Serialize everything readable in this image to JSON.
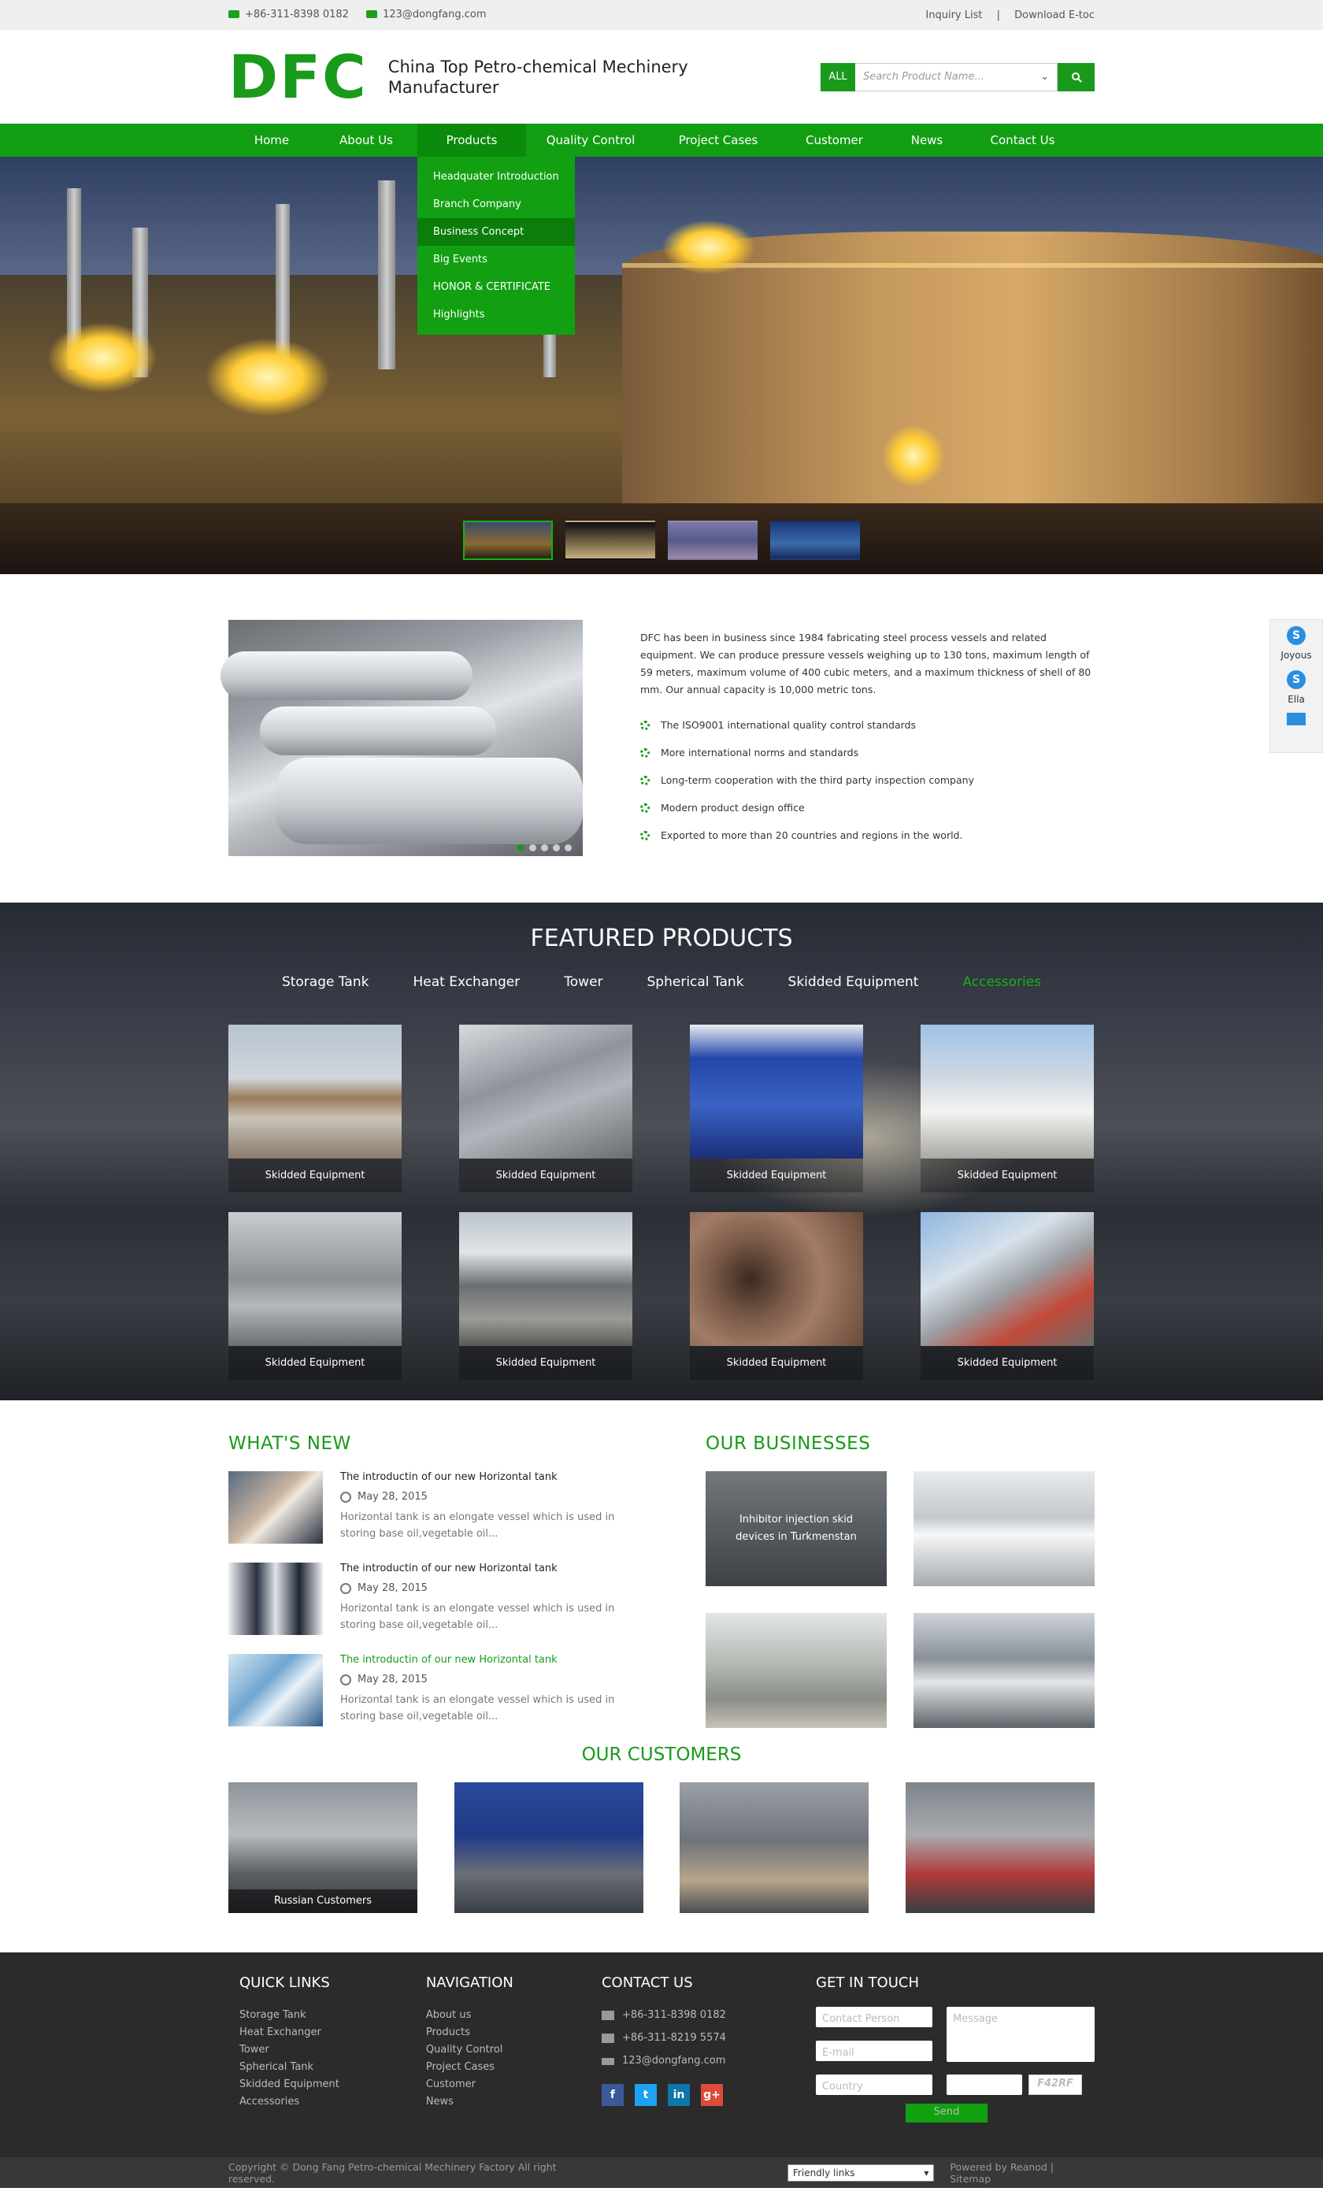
{
  "topbar": {
    "phone": "+86-311-8398 0182",
    "email": "123@dongfang.com",
    "inquiry": "Inquiry List",
    "separator": "|",
    "download": "Download E-toc"
  },
  "header": {
    "logo": "DFC",
    "tagline": "China Top Petro-chemical Mechinery Manufacturer",
    "search_scope": "ALL",
    "search_placeholder": "Search Product Name..."
  },
  "nav": {
    "items": [
      "Home",
      "About Us",
      "Products",
      "Quality Control",
      "Project Cases",
      "Customer",
      "News",
      "Contact Us"
    ],
    "active": "Products",
    "dropdown": [
      "Headquater Introduction",
      "Branch Company",
      "Business Concept",
      "Big Events",
      "HONOR & CERTIFICATE",
      "Highlights"
    ],
    "dropdown_highlight": "Business Concept"
  },
  "intro": {
    "text": "DFC has been in business since 1984 fabricating steel process vessels and related equipment. We can produce pressure vessels weighing up to 130 tons, maximum length of 59 meters, maximum volume of 400 cubic meters, and a maximum thickness of shell of 80 mm. Our annual capacity is 10,000 metric tons.",
    "features": [
      "The ISO9001 international quality control standards",
      "More international norms and standards",
      "Long-term cooperation with the third party inspection company",
      "Modern product design office",
      "Exported to more than 20 countries and regions in the world."
    ]
  },
  "side": {
    "contact1": "Joyous",
    "contact2": "Ella"
  },
  "featured": {
    "title": "FEATURED PRODUCTS",
    "tabs": [
      "Storage Tank",
      "Heat Exchanger",
      "Tower",
      "Spherical Tank",
      "Skidded Equipment",
      "Accessories"
    ],
    "active_tab": "Accessories",
    "products": [
      "Skidded Equipment",
      "Skidded Equipment",
      "Skidded Equipment",
      "Skidded Equipment",
      "Skidded Equipment",
      "Skidded Equipment",
      "Skidded Equipment",
      "Skidded Equipment"
    ]
  },
  "news": {
    "title": "WHAT'S NEW",
    "items": [
      {
        "title": "The introductin of our new Horizontal tank",
        "date": "May 28, 2015",
        "summary": "Horizontal tank is an elongate vessel which is used in storing base oil,vegetable oil..."
      },
      {
        "title": "The introductin of our new Horizontal tank",
        "date": "May 28, 2015",
        "summary": "Horizontal tank is an elongate vessel which is used in storing base oil,vegetable oil..."
      },
      {
        "title": "The introductin of our new Horizontal tank",
        "date": "May 28, 2015",
        "summary": "Horizontal tank is an elongate vessel which is used in storing base oil,vegetable oil..."
      }
    ]
  },
  "businesses": {
    "title": "OUR BUSINESSES",
    "overlay": "Inhibitor injection skid devices in Turkmenstan"
  },
  "customers": {
    "title": "OUR CUSTOMERS",
    "caption": "Russian Customers"
  },
  "footer": {
    "quick_title": "QUICK LINKS",
    "quick": [
      "Storage Tank",
      "Heat Exchanger",
      "Tower",
      "Spherical Tank",
      "Skidded Equipment",
      "Accessories"
    ],
    "nav_title": "NAVIGATION",
    "nav": [
      "About us",
      "Products",
      "Quality Control",
      "Project Cases",
      "Customer",
      "News"
    ],
    "contact_title": "CONTACT US",
    "tel": "+86-311-8398 0182",
    "fax": "+86-311-8219 5574",
    "email": "123@dongfang.com",
    "social": [
      "f",
      "t",
      "in",
      "g+"
    ],
    "touch_title": "GET IN TOUCH",
    "ph_person": "Contact Person",
    "ph_email": "E-mail",
    "ph_country": "Country",
    "ph_message": "Message",
    "captcha": "F42RF",
    "send": "Send",
    "top_arrow": "︿"
  },
  "bottom": {
    "copyright": "Copyright © Dong Fang Petro-chemical Mechinery Factory All right reserved.",
    "friendly": "Friendly links",
    "powered": "Powered by Reanod | Sitemap"
  },
  "colors": {
    "brand_green": "#129e12",
    "footer_bg": "#2b2b2b"
  }
}
